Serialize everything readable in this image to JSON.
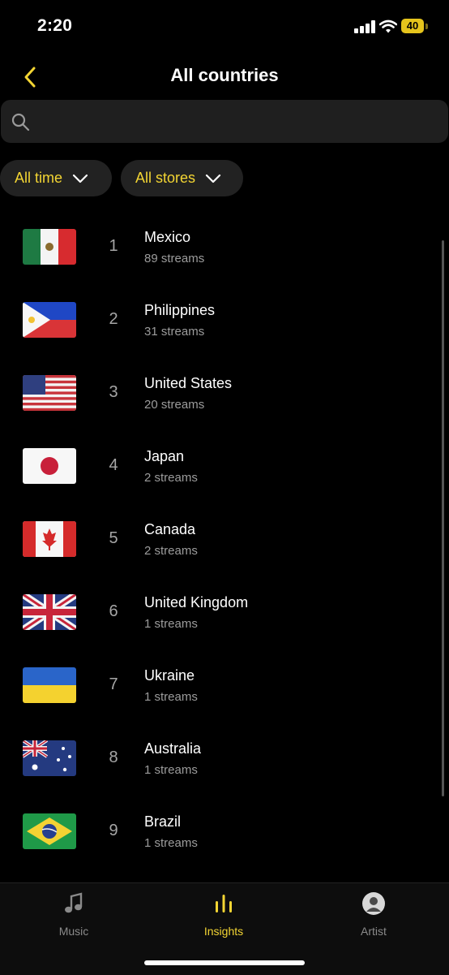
{
  "status_bar": {
    "time": "2:20",
    "battery": "40"
  },
  "header": {
    "title": "All countries"
  },
  "search": {
    "placeholder": ""
  },
  "filters": {
    "time": "All time",
    "store": "All stores"
  },
  "countries": [
    {
      "rank": "1",
      "name": "Mexico",
      "streams": "89 streams",
      "flag": "mexico"
    },
    {
      "rank": "2",
      "name": "Philippines",
      "streams": "31 streams",
      "flag": "philippines"
    },
    {
      "rank": "3",
      "name": "United States",
      "streams": "20 streams",
      "flag": "united-states"
    },
    {
      "rank": "4",
      "name": "Japan",
      "streams": "2 streams",
      "flag": "japan"
    },
    {
      "rank": "5",
      "name": "Canada",
      "streams": "2 streams",
      "flag": "canada"
    },
    {
      "rank": "6",
      "name": "United Kingdom",
      "streams": "1 streams",
      "flag": "united-kingdom"
    },
    {
      "rank": "7",
      "name": "Ukraine",
      "streams": "1 streams",
      "flag": "ukraine"
    },
    {
      "rank": "8",
      "name": "Australia",
      "streams": "1 streams",
      "flag": "australia"
    },
    {
      "rank": "9",
      "name": "Brazil",
      "streams": "1 streams",
      "flag": "brazil"
    }
  ],
  "tabs": [
    {
      "label": "Music",
      "icon": "music-note-icon",
      "active": false
    },
    {
      "label": "Insights",
      "icon": "bar-chart-icon",
      "active": true
    },
    {
      "label": "Artist",
      "icon": "avatar",
      "active": false
    }
  ],
  "colors": {
    "accent": "#f3d533",
    "inactive": "#8a8a8a",
    "background": "#000000"
  }
}
